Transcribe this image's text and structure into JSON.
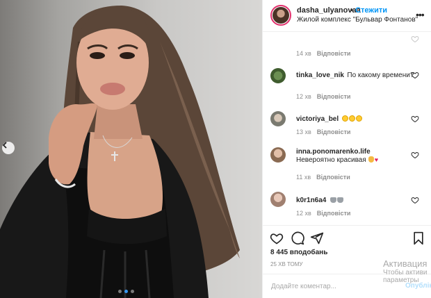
{
  "header": {
    "username": "dasha_ulyanovaa",
    "separator": "•",
    "follow_label": "Стежити",
    "location": "Жилой комплекс \"Бульвар Фонтанов\"",
    "more_label": "•••"
  },
  "faded_comment": {
    "time": "14 хв",
    "reply_label": "Відповісти"
  },
  "comments": [
    {
      "username": "tinka_love_nik",
      "text": "По какому времени?",
      "time": "12 хв",
      "reply_label": "Відповісти"
    },
    {
      "username": "victoriya_bel",
      "text": "",
      "emoji": [
        "smile-emoji",
        "smile-emoji",
        "smile-emoji"
      ],
      "time": "13 хв",
      "reply_label": "Відповісти"
    },
    {
      "username": "inna.ponomarenko.life",
      "text": "Невероятно красивая",
      "emoji": [
        "hand-emoji",
        "heart-emoji"
      ],
      "time": "11 хв",
      "reply_label": "Відповісти"
    },
    {
      "username": "k0r1n6a4",
      "text": "",
      "emoji": [
        "cat-emoji",
        "cat-emoji"
      ],
      "time": "12 хв",
      "reply_label": "Відповісти"
    }
  ],
  "actions": {
    "icons": [
      "heart-icon",
      "comment-icon",
      "share-icon",
      "bookmark-icon"
    ]
  },
  "likes": "8 445 вподобань",
  "posted_time": "25 ХВ ТОМУ",
  "add_comment": {
    "placeholder": "Додайте коментар...",
    "post_label": "Опублікувати"
  },
  "watermark": {
    "line1": "Активация",
    "line2": "Чтобы активи",
    "line3": "параметры"
  },
  "colors": {
    "accent": "#0095f6",
    "border": "#efefef",
    "muted": "#8e8e8e",
    "carousel_active": "#3897f0"
  }
}
